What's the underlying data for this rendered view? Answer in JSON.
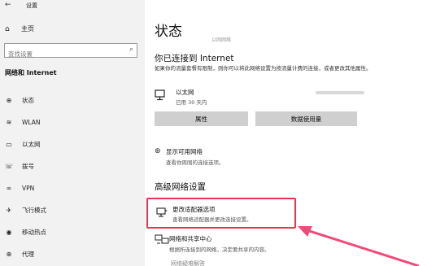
{
  "window": {
    "title": "设置",
    "back": "←"
  },
  "sidebar": {
    "home_label": "主页",
    "search_placeholder": "查找设置",
    "section_title": "网络和 Internet",
    "items": [
      {
        "label": "状态",
        "icon": "globe-icon",
        "glyph": "⊕"
      },
      {
        "label": "WLAN",
        "icon": "wifi-icon",
        "glyph": "≋"
      },
      {
        "label": "以太网",
        "icon": "ethernet-icon",
        "glyph": "▭"
      },
      {
        "label": "拨号",
        "icon": "dialup-icon",
        "glyph": "☏"
      },
      {
        "label": "VPN",
        "icon": "vpn-icon",
        "glyph": "∞"
      },
      {
        "label": "飞行模式",
        "icon": "airplane-icon",
        "glyph": "✈"
      },
      {
        "label": "移动热点",
        "icon": "hotspot-icon",
        "glyph": "◉"
      },
      {
        "label": "代理",
        "icon": "proxy-icon",
        "glyph": "⊕"
      }
    ]
  },
  "main": {
    "title": "状态",
    "faded_text": "以网网络",
    "connected_title": "你已连接到 Internet",
    "connected_desc": "如果你的流量套餐有限制，则你可以将此网络设置为按流量计费的连接，或者更改其他属性。",
    "ethernet_name": "以太网",
    "ethernet_sub": "已用 30 天内",
    "properties_label": "属性",
    "data_usage_label": "数据使用量",
    "available_title": "显示可用网络",
    "available_desc": "查看你周围的连接选项。",
    "advanced_title": "高级网络设置",
    "adapter_title": "更改适配器选项",
    "adapter_desc": "查看网络适配器并更改连接设置。",
    "sharing_title": "网络和共享中心",
    "sharing_desc": "根据所连接到的网络，决定要共享的内容。",
    "cutoff_text": "网络疑难解答"
  },
  "colors": {
    "highlight": "#e8364f",
    "sidebar_bg": "#f2f2f2",
    "button_bg": "#cfcfcf"
  }
}
